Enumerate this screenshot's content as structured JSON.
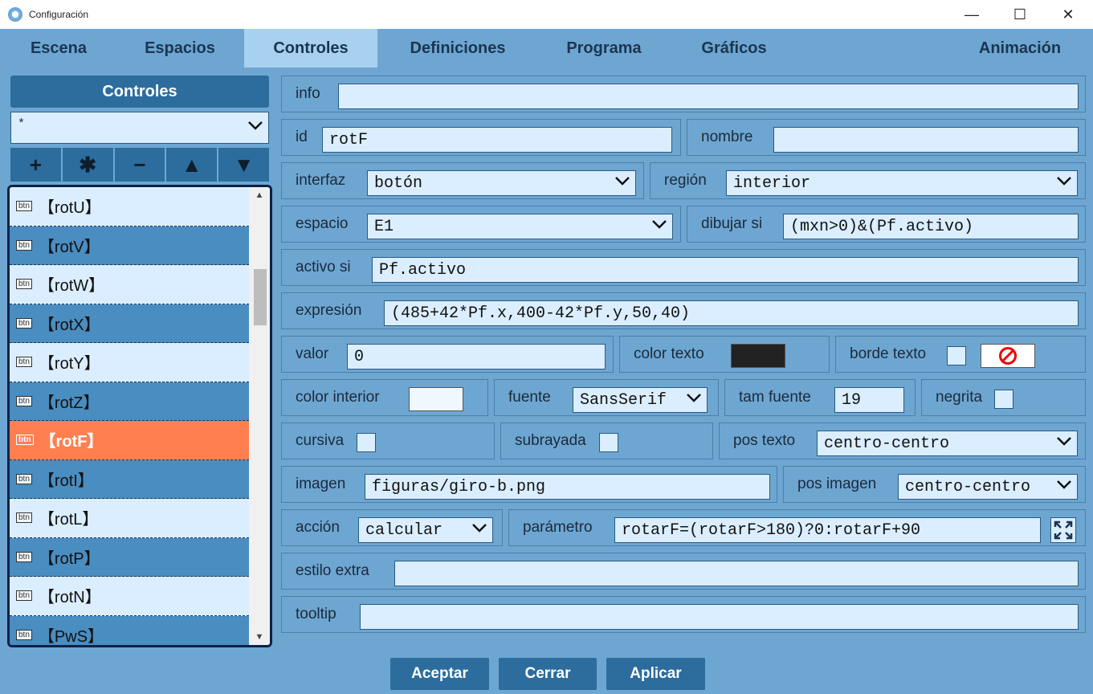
{
  "window": {
    "title": "Configuración",
    "minimize": "—",
    "maximize": "☐",
    "close": "✕"
  },
  "tabs": [
    "Escena",
    "Espacios",
    "Controles",
    "Definiciones",
    "Programa",
    "Gráficos",
    "Animación"
  ],
  "left": {
    "header": "Controles",
    "filter_value": "*",
    "tool_buttons": [
      "+",
      "✱",
      "−",
      "▲",
      "▼"
    ],
    "badge": "btn",
    "items": [
      "【rotU】",
      "【rotV】",
      "【rotW】",
      "【rotX】",
      "【rotY】",
      "【rotZ】",
      "【rotF】",
      "【rotI】",
      "【rotL】",
      "【rotP】",
      "【rotN】",
      "【PwS】"
    ],
    "selected_index": 6
  },
  "form": {
    "info": {
      "label": "info",
      "value": ""
    },
    "id": {
      "label": "id",
      "value": "rotF"
    },
    "nombre": {
      "label": "nombre",
      "value": ""
    },
    "interfaz": {
      "label": "interfaz",
      "value": "botón"
    },
    "region": {
      "label": "región",
      "value": "interior"
    },
    "espacio": {
      "label": "espacio",
      "value": "E1"
    },
    "dibujar_si": {
      "label": "dibujar si",
      "value": "(mxn>0)&(Pf.activo)"
    },
    "activo_si": {
      "label": "activo si",
      "value": "Pf.activo"
    },
    "expresion": {
      "label": "expresión",
      "value": "(485+42*Pf.x,400-42*Pf.y,50,40)"
    },
    "valor": {
      "label": "valor",
      "value": "0"
    },
    "color_texto": {
      "label": "color texto",
      "color": "#222222"
    },
    "borde_texto": {
      "label": "borde texto",
      "icon": "no-symbol-icon"
    },
    "color_interior": {
      "label": "color interior",
      "color": "#f0f8ff"
    },
    "fuente": {
      "label": "fuente",
      "value": "SansSerif"
    },
    "tam_fuente": {
      "label": "tam fuente",
      "value": "19"
    },
    "negrita": {
      "label": "negrita"
    },
    "cursiva": {
      "label": "cursiva"
    },
    "subrayada": {
      "label": "subrayada"
    },
    "pos_texto": {
      "label": "pos texto",
      "value": "centro-centro"
    },
    "imagen": {
      "label": "imagen",
      "value": "figuras/giro-b.png"
    },
    "pos_imagen": {
      "label": "pos imagen",
      "value": "centro-centro"
    },
    "accion": {
      "label": "acción",
      "value": "calcular"
    },
    "parametro": {
      "label": "parámetro",
      "value": "rotarF=(rotarF>180)?0:rotarF+90"
    },
    "estilo_extra": {
      "label": "estilo extra",
      "value": ""
    },
    "tooltip": {
      "label": "tooltip",
      "value": ""
    }
  },
  "buttons": {
    "accept": "Aceptar",
    "close": "Cerrar",
    "apply": "Aplicar"
  }
}
